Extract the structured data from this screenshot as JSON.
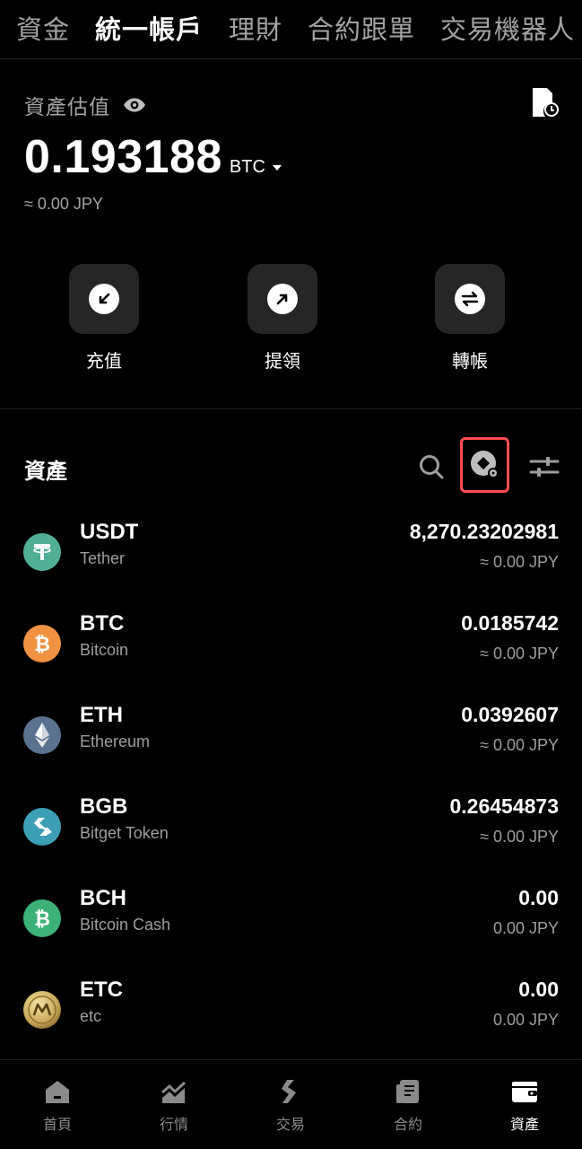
{
  "top_tabs": [
    {
      "label": "資金"
    },
    {
      "label": "統一帳戶"
    },
    {
      "label": "理財"
    },
    {
      "label": "合約跟單"
    },
    {
      "label": "交易機器人"
    }
  ],
  "summary": {
    "label": "資產估值",
    "balance": "0.193188",
    "unit": "BTC",
    "fiat": "≈ 0.00 JPY"
  },
  "actions": [
    {
      "label": "充值",
      "icon": "deposit-arrow-icon"
    },
    {
      "label": "提領",
      "icon": "withdraw-arrow-icon"
    },
    {
      "label": "轉帳",
      "icon": "transfer-arrows-icon"
    }
  ],
  "assets": {
    "title": "資產",
    "list": [
      {
        "symbol": "USDT",
        "name": "Tether",
        "amount": "8,270.23202981",
        "fiat": "≈ 0.00 JPY",
        "color": "#50af95"
      },
      {
        "symbol": "BTC",
        "name": "Bitcoin",
        "amount": "0.0185742",
        "fiat": "≈ 0.00 JPY",
        "color": "#f09242"
      },
      {
        "symbol": "ETH",
        "name": "Ethereum",
        "amount": "0.0392607",
        "fiat": "≈ 0.00 JPY",
        "color": "#5a7290"
      },
      {
        "symbol": "BGB",
        "name": "Bitget Token",
        "amount": "0.26454873",
        "fiat": "≈ 0.00 JPY",
        "color": "#3d9fb5"
      },
      {
        "symbol": "BCH",
        "name": "Bitcoin Cash",
        "amount": "0.00",
        "fiat": "0.00 JPY",
        "color": "#3cb178"
      },
      {
        "symbol": "ETC",
        "name": "etc",
        "amount": "0.00",
        "fiat": "0.00 JPY",
        "color": "#c9a85a"
      }
    ]
  },
  "bottom_nav": [
    {
      "label": "首頁"
    },
    {
      "label": "行情"
    },
    {
      "label": "交易"
    },
    {
      "label": "合約"
    },
    {
      "label": "資產"
    }
  ],
  "colors": {
    "background": "#000000",
    "card": "#262626",
    "highlight": "#ff4d4f",
    "muted": "#a3a3a3"
  }
}
